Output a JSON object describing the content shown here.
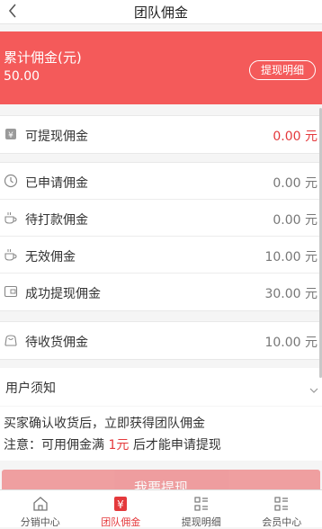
{
  "header": {
    "title": "团队佣金"
  },
  "banner": {
    "label": "累计佣金(元)",
    "amount": "50.00",
    "detail_button": "提现明细"
  },
  "rows_group1": [
    {
      "label": "可提现佣金",
      "value": "0.00 元",
      "icon": "wallet-icon"
    }
  ],
  "rows_group2": [
    {
      "label": "已申请佣金",
      "value": "0.00 元",
      "icon": "clock-icon"
    },
    {
      "label": "待打款佣金",
      "value": "0.00 元",
      "icon": "coffee-cup-icon"
    },
    {
      "label": "无效佣金",
      "value": "10.00 元",
      "icon": "coffee-cup-icon"
    },
    {
      "label": "成功提现佣金",
      "value": "30.00 元",
      "icon": "card-icon"
    }
  ],
  "rows_group3": [
    {
      "label": "待收货佣金",
      "value": "10.00 元",
      "icon": "bag-icon"
    }
  ],
  "notice": {
    "title": "用户须知",
    "line1": "买家确认收货后，立即获得团队佣金",
    "line2_prefix": "注意：可用佣金满 ",
    "line2_amount": "1元",
    "line2_suffix": " 后才能申请提现"
  },
  "apply_button": "我要提现",
  "tabs": [
    {
      "label": "分销中心",
      "icon": "home-icon"
    },
    {
      "label": "团队佣金",
      "icon": "yen-icon"
    },
    {
      "label": "提现明细",
      "icon": "list-icon"
    },
    {
      "label": "会员中心",
      "icon": "list-icon"
    }
  ],
  "colors": {
    "accent": "#f45a5a",
    "highlight_text": "#e4393c"
  }
}
